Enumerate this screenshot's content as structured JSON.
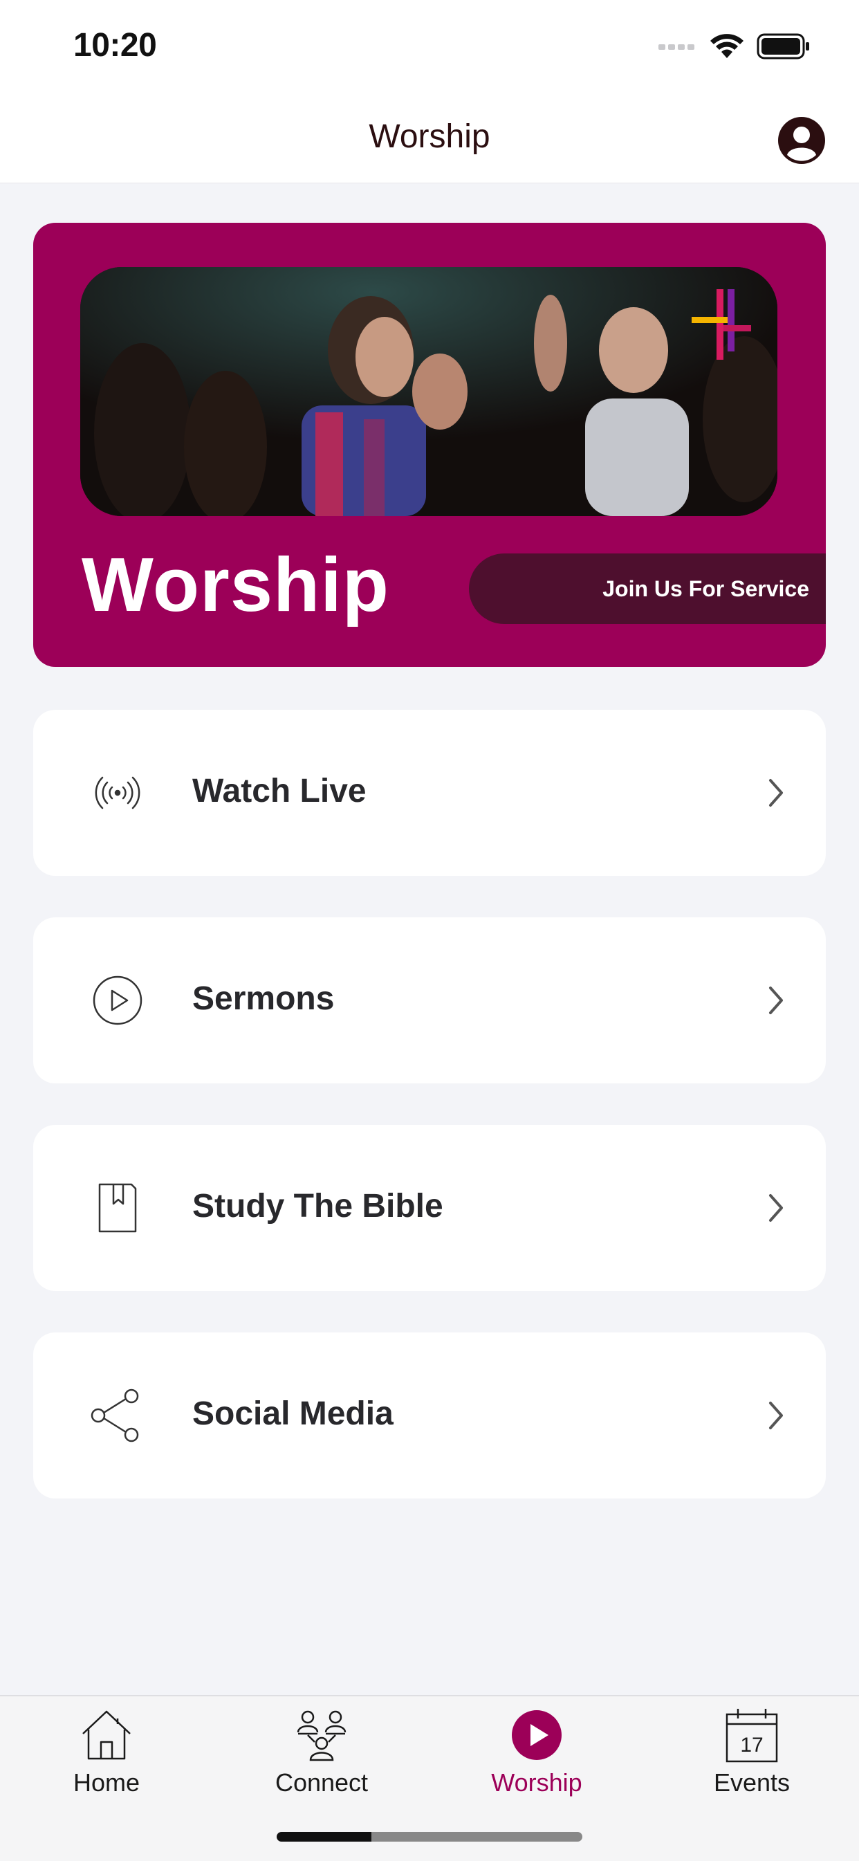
{
  "status_bar": {
    "time": "10:20"
  },
  "header": {
    "title": "Worship"
  },
  "banner": {
    "title": "Worship",
    "button_label": "Join Us For Service"
  },
  "menu": [
    {
      "label": "Watch Live",
      "icon": "live-broadcast-icon"
    },
    {
      "label": "Sermons",
      "icon": "play-circle-icon"
    },
    {
      "label": "Study The Bible",
      "icon": "bible-book-icon"
    },
    {
      "label": "Social Media",
      "icon": "share-icon"
    }
  ],
  "tabbar": {
    "items": [
      {
        "label": "Home",
        "icon": "home-icon"
      },
      {
        "label": "Connect",
        "icon": "people-icon"
      },
      {
        "label": "Worship",
        "icon": "play-circle-filled-icon",
        "active": true
      },
      {
        "label": "Events",
        "icon": "calendar-icon"
      }
    ]
  },
  "colors": {
    "accent": "#9c0058",
    "button_dark": "#4e0f2e",
    "background": "#f3f4f8"
  }
}
